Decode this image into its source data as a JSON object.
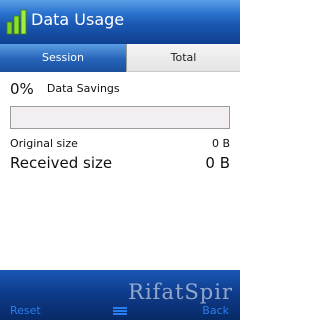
{
  "app": {
    "title": "Data Usage"
  },
  "tabs": [
    {
      "label": "Session",
      "selected": true
    },
    {
      "label": "Total",
      "selected": false
    }
  ],
  "session": {
    "savings_percent": "0%",
    "savings_label": "Data Savings",
    "savings_fraction": 0,
    "original_label": "Original size",
    "original_value": "0 B",
    "received_label": "Received size",
    "received_value": "0 B"
  },
  "softkeys": {
    "left": "Reset",
    "right": "Back"
  },
  "watermark": "RifatSpir",
  "colors": {
    "title_bar": "#1b58b3",
    "tab_selected": "#2563b8",
    "tab_unselected": "#e9e9e9",
    "softkey_text": "#2a7df0",
    "progress_fill": "#3a78c8"
  },
  "icons": {
    "app": "bar-chart-icon",
    "center_softkey": "menu-icon"
  }
}
